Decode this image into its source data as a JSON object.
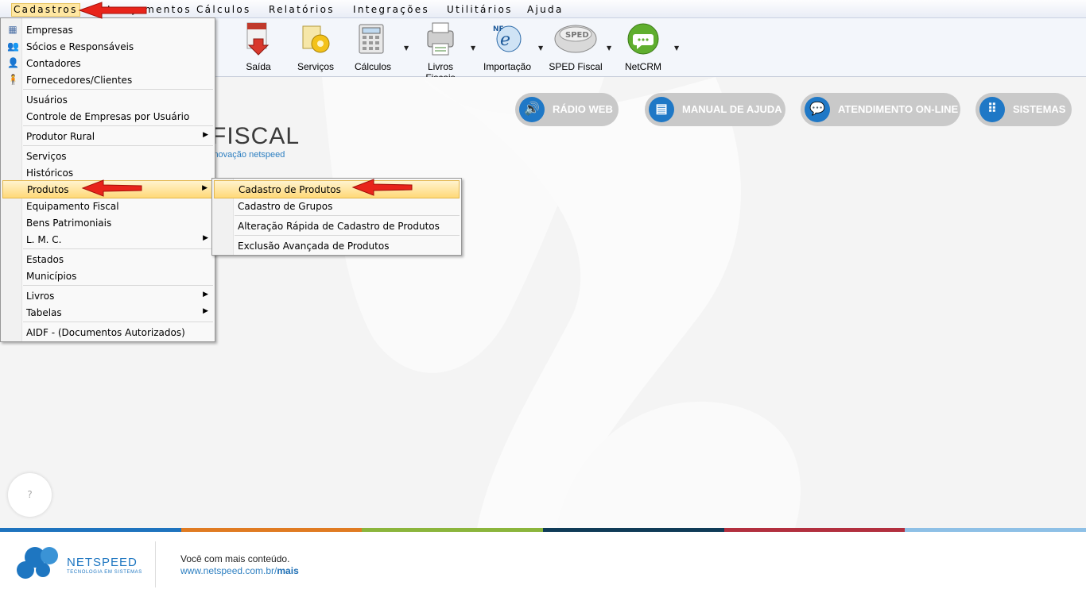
{
  "menubar": {
    "items": [
      {
        "label": "Cadastros"
      },
      {
        "label": "Lançamentos"
      },
      {
        "label": "Cálculos"
      },
      {
        "label": "Relatórios"
      },
      {
        "label": "Integrações"
      },
      {
        "label": "Utilitários"
      },
      {
        "label": "Ajuda"
      }
    ]
  },
  "toolbar": {
    "buttons": [
      {
        "label": "Saída",
        "icon": "saida-icon"
      },
      {
        "label": "Serviços",
        "icon": "servicos-icon"
      },
      {
        "label": "Cálculos",
        "icon": "calculos-icon"
      },
      {
        "label": "Livros Fiscais",
        "icon": "livros-fiscais-icon"
      },
      {
        "label": "Importação",
        "icon": "nfe-importacao-icon"
      },
      {
        "label": "SPED Fiscal",
        "icon": "sped-icon"
      },
      {
        "label": "NetCRM",
        "icon": "netcrm-chat-icon"
      }
    ]
  },
  "quick_links": [
    {
      "label": "RÁDIO WEB",
      "icon": "speaker-icon"
    },
    {
      "label": "MANUAL DE AJUDA",
      "icon": "book-icon"
    },
    {
      "label": "ATENDIMENTO ON-LINE",
      "icon": "chat-icon"
    },
    {
      "label": "SISTEMAS",
      "icon": "grid-icon"
    }
  ],
  "branding": {
    "fiscal_text": "FISCAL",
    "tagline": "inovação netspeed",
    "help_bubble": "?"
  },
  "cadastros_menu": {
    "items": [
      {
        "label": "Empresas"
      },
      {
        "label": "Sócios e Responsáveis"
      },
      {
        "label": "Contadores"
      },
      {
        "label": "Fornecedores/Clientes"
      },
      {
        "label": "Usuários"
      },
      {
        "label": "Controle de Empresas por Usuário"
      },
      {
        "label": "Produtor Rural"
      },
      {
        "label": "Serviços"
      },
      {
        "label": "Históricos"
      },
      {
        "label": "Produtos"
      },
      {
        "label": "Equipamento Fiscal"
      },
      {
        "label": "Bens Patrimoniais"
      },
      {
        "label": "L. M. C."
      },
      {
        "label": "Estados"
      },
      {
        "label": "Municípios"
      },
      {
        "label": "Livros"
      },
      {
        "label": "Tabelas"
      },
      {
        "label": "AIDF - (Documentos Autorizados)"
      }
    ]
  },
  "produtos_submenu": {
    "items": [
      {
        "label": "Cadastro de Produtos"
      },
      {
        "label": "Cadastro de Grupos"
      },
      {
        "label": "Alteração Rápida de Cadastro de Produtos"
      },
      {
        "label": "Exclusão Avançada de Produtos"
      }
    ]
  },
  "footer": {
    "brand": "NETSPEED",
    "brand_sub": "TECNOLOGIA EM SISTEMAS",
    "slogan": "Você com mais conteúdo.",
    "site_prefix": "www.netspeed.com.br/",
    "site_suffix": "mais"
  },
  "colors": {
    "strip": [
      "#1e73be",
      "#e07b22",
      "#8bb53c",
      "#0f3b57",
      "#b22f3e",
      "#8ec0e6"
    ],
    "accent": "#1e78c6"
  }
}
